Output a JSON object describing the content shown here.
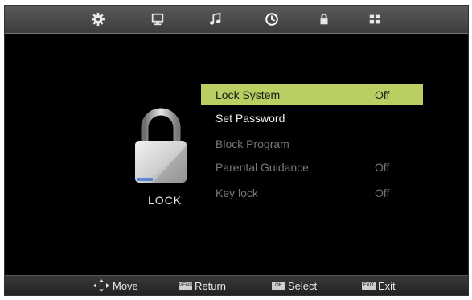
{
  "top_tabs": [
    {
      "icon": "gear-icon"
    },
    {
      "icon": "monitor-icon"
    },
    {
      "icon": "music-note-icon"
    },
    {
      "icon": "clock-icon",
      "active": true
    },
    {
      "icon": "padlock-icon"
    },
    {
      "icon": "grid-icon"
    }
  ],
  "lock_panel": {
    "title": "LOCK"
  },
  "menu": {
    "items": [
      {
        "label": "Lock System",
        "value": "Off",
        "state": "selected"
      },
      {
        "label": "Set Password",
        "value": "",
        "state": "enabled"
      },
      {
        "label": "Block Program",
        "value": "",
        "state": "disabled"
      },
      {
        "label": "Parental Guidance",
        "value": "Off",
        "state": "disabled"
      },
      {
        "label": "Key lock",
        "value": "Off",
        "state": "disabled"
      }
    ]
  },
  "footer": {
    "move": "Move",
    "return": "Return",
    "select": "Select",
    "exit": "Exit"
  },
  "colors": {
    "highlight": "#b9cf62",
    "background": "#000000"
  }
}
